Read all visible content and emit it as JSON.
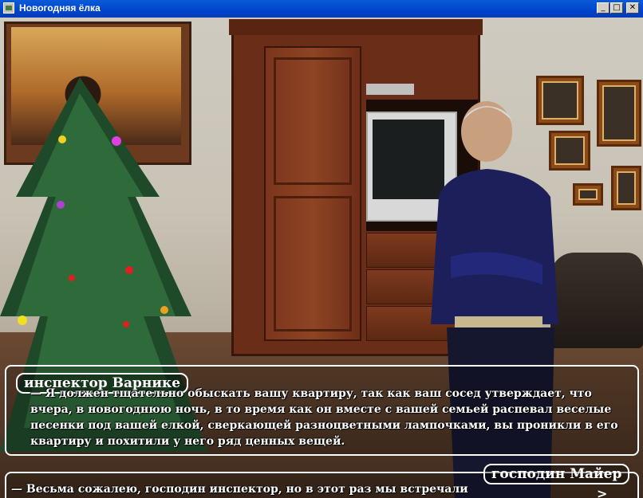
{
  "window": {
    "title": "Новогодняя ёлка",
    "minimize": "_",
    "maximize": "□",
    "close": "✕"
  },
  "dialog": {
    "speaker1": "инспектор Варнике",
    "line1": "— Я должен тщательно обыскать вашу квартиру, так как ваш сосед утверждает, что вчера, в новогоднюю ночь, в то время как он вместе с вашей семьей распевал веселые песенки под вашей елкой, сверкающей разноцветными лампочками, вы проникли в его квартиру и похитили у него ряд ценных вещей.",
    "speaker2": "господин Майер",
    "line2": "— Весьма сожалею, господин инспектор, но в этот раз мы встречали",
    "continue": ">"
  },
  "colors": {
    "title_bar": "#0044cc",
    "dialog_border": "#ffffff",
    "text": "#ffffff"
  }
}
